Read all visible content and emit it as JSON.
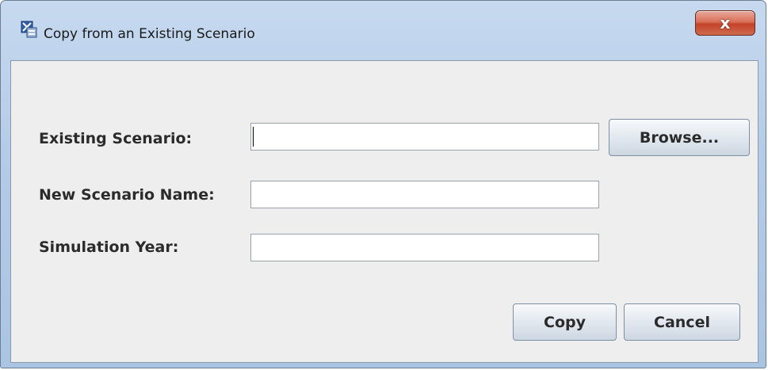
{
  "window": {
    "title": "Copy from an Existing Scenario",
    "app_icon": "scenario-app-icon",
    "close_glyph": "x"
  },
  "form": {
    "existing_scenario": {
      "label": "Existing Scenario:",
      "value": ""
    },
    "new_scenario_name": {
      "label": "New Scenario Name:",
      "value": ""
    },
    "simulation_year": {
      "label": "Simulation Year:",
      "value": ""
    }
  },
  "buttons": {
    "browse": "Browse...",
    "copy": "Copy",
    "cancel": "Cancel"
  },
  "colors": {
    "close_button": "#c4432a",
    "dialog_background": "#eeeeee",
    "window_frame": "#b5cce8"
  }
}
